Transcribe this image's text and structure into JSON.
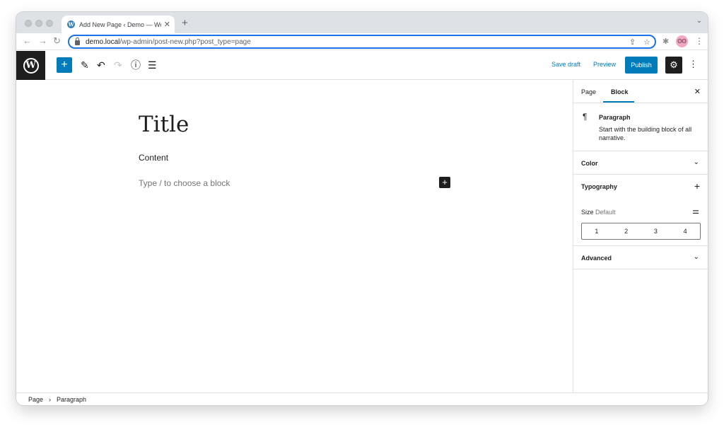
{
  "browser": {
    "tab_title": "Add New Page ‹ Demo — Word",
    "tab_close": "✕",
    "new_tab": "+",
    "tab_menu": "⌄",
    "url_host": "demo.local",
    "url_path": "/wp-admin/post-new.php?post_type=page",
    "icons": [
      "back-arrow-icon",
      "forward-arrow-icon",
      "reload-icon",
      "lock-icon",
      "share-icon",
      "bookmark-star-icon",
      "extensions-icon",
      "profile-avatar-icon",
      "browser-menu-icon"
    ]
  },
  "wp_header": {
    "logo": "W",
    "save_draft": "Save draft",
    "preview": "Preview",
    "publish": "Publish",
    "icons": [
      "wordpress-logo-icon",
      "add-block-icon",
      "edit-pencil-icon",
      "undo-icon",
      "redo-icon",
      "info-icon",
      "list-view-icon",
      "settings-gear-icon",
      "options-kebab-icon"
    ]
  },
  "editor": {
    "title": "Title",
    "content": "Content",
    "appender_placeholder": "Type / to choose a block"
  },
  "sidebar": {
    "tabs": [
      {
        "label": "Page",
        "active": false
      },
      {
        "label": "Block",
        "active": true
      }
    ],
    "block": {
      "name": "Paragraph",
      "description": "Start with the building block of all narrative."
    },
    "panels": {
      "color": "Color",
      "typography": "Typography",
      "advanced": "Advanced"
    },
    "size_label": "Size",
    "size_value": "Default",
    "size_options": [
      "1",
      "2",
      "3",
      "4"
    ]
  },
  "breadcrumb": [
    "Page",
    "Paragraph"
  ],
  "colors": {
    "accent": "#007cba",
    "dark": "#1e1e1e",
    "focus_ring": "#1a73e8"
  }
}
